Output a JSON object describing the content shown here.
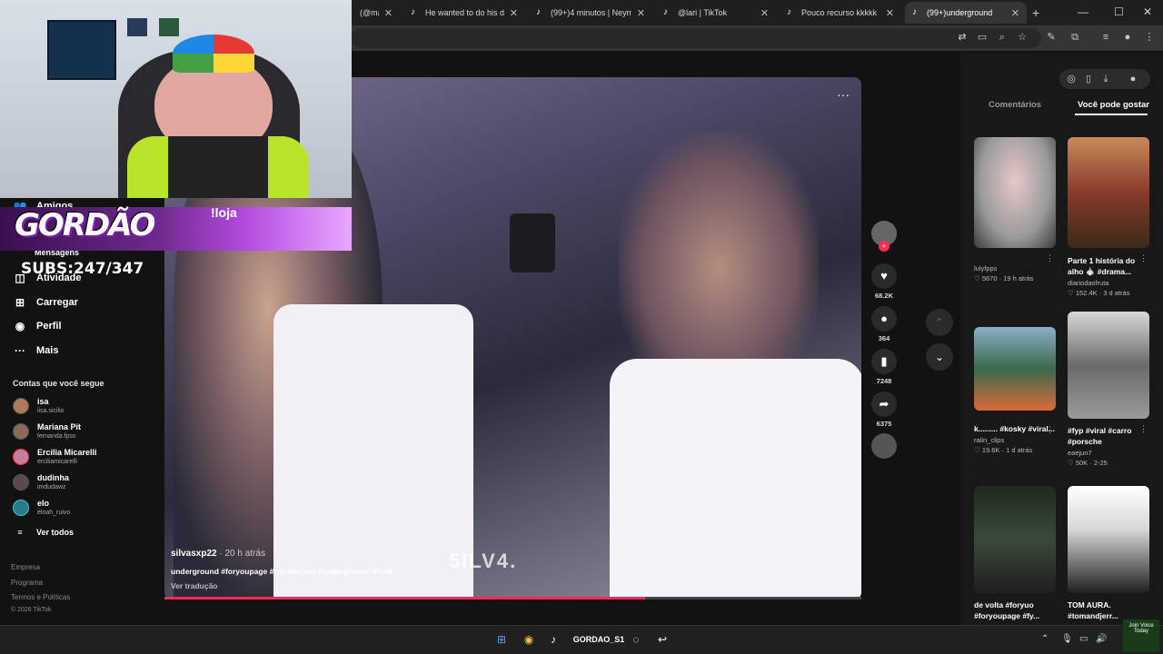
{
  "browser": {
    "tabs": [
      {
        "title": "(@mah",
        "active": false
      },
      {
        "title": "He wanted to do his danc",
        "active": false
      },
      {
        "title": "(99+)4 minutos | Neymar",
        "active": false
      },
      {
        "title": "@lari | TikTok",
        "active": false
      },
      {
        "title": "Pouco recurso kkkkk",
        "active": false
      },
      {
        "title": "(99+)underground",
        "active": true
      }
    ],
    "new_tab": "+",
    "min": "—",
    "max": "☐",
    "close": "✕"
  },
  "sidebar": {
    "items": [
      {
        "label": "Amigos",
        "icon": "people-icon"
      },
      {
        "label": "Mensagens",
        "icon": "message-icon"
      },
      {
        "label": "Atividade",
        "icon": "activity-icon"
      },
      {
        "label": "Carregar",
        "icon": "upload-icon"
      },
      {
        "label": "Perfil",
        "icon": "profile-icon"
      },
      {
        "label": "Mais",
        "icon": "more-icon"
      }
    ],
    "following_title": "Contas que você segue",
    "following": [
      {
        "name": "isa",
        "handle": "iisa.sicilio",
        "color": "#b07a5a"
      },
      {
        "name": "Mariana Pit",
        "handle": "fernanda.fpss",
        "color": "#8a6a5a"
      },
      {
        "name": "Ercilia Micarelli",
        "handle": "erciliamicarelli",
        "color": "#c57f9a"
      },
      {
        "name": "dudinha",
        "handle": "imdudawz",
        "color": "#5a4a4a"
      },
      {
        "name": "elo",
        "handle": "eloah_ruivo",
        "color": "#2a7a8a"
      }
    ],
    "see_all": "Ver todos",
    "footer": [
      "Empresa",
      "Programa",
      "Termos e Políticas",
      "© 2026 TikTok"
    ]
  },
  "stream_overlay": {
    "logo": "GORDÃO",
    "subs": "SUBS:247/347",
    "loja": "!loja"
  },
  "video": {
    "username": "silvasxp22",
    "posted": " · 20 h atrás",
    "caption": "underground #foryoupage #fyp #foryou #underground #funk",
    "translate": "Ver tradução",
    "watermark": "5ILV4.",
    "more": "···",
    "progress": 0.69
  },
  "actions": {
    "likes": "68.2K",
    "comments": "364",
    "saves": "7248",
    "shares": "6375"
  },
  "right_panel": {
    "tab_comments": "Comentários",
    "tab_suggest": "Você pode gostar",
    "cards": [
      {
        "title": "",
        "user": "lulyfpps",
        "likes": "5670",
        "when": "19 h atrás",
        "bg": "#c9c5c8"
      },
      {
        "title": "Parte 1 história do alho 🧄 #drama...",
        "user": "diariodasfruta",
        "likes": "152.4K",
        "when": "3 d atrás",
        "bg": "#8a5a3a"
      },
      {
        "title": "k......... #kosky #viral...",
        "user": "ralin_clips",
        "likes": "19.6K",
        "when": "1 d atrás",
        "bg": "#3a6a4a"
      },
      {
        "title": "#fyp #viral #carro #porsche",
        "user": "eaejun7",
        "likes": "50K",
        "when": "2-25",
        "bg": "#8a8a8a"
      },
      {
        "title": "de volta #foryuo #foryoupage #fy...",
        "user": "",
        "likes": "",
        "when": "",
        "bg": "#1e2a1e"
      },
      {
        "title": "TOM AURA. #tomandjerr...",
        "user": "",
        "likes": "",
        "when": "",
        "bg": "#d8d8d8"
      }
    ]
  },
  "taskbar": {
    "stream_label": "GORDAO_S1",
    "tray_text": "Join Voice Today"
  }
}
